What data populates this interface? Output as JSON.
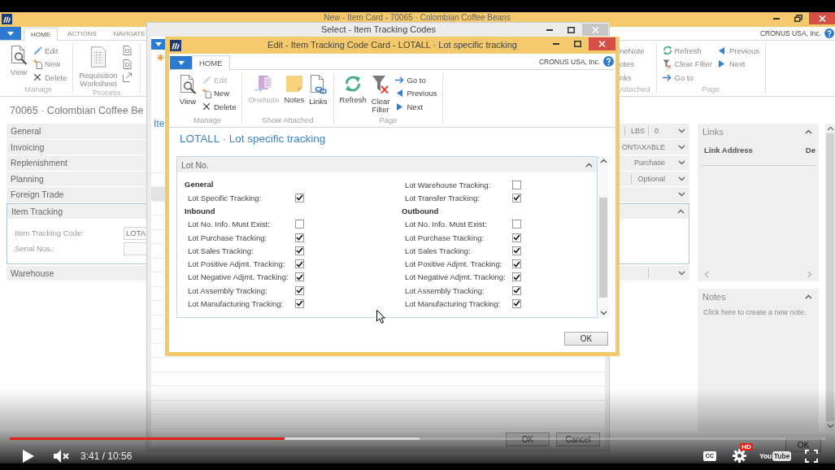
{
  "background_window": {
    "title": "New - Item Card - 70065 · Colombian Coffee Beans",
    "active": true,
    "maximized": true,
    "tabs": [
      {
        "label": "HOME",
        "selected": true
      },
      {
        "label": "ACTIONS",
        "selected": false
      },
      {
        "label": "NAVIGATE",
        "selected": false
      }
    ],
    "company": "CRONUS USA, Inc.",
    "ribbon_left": [
      {
        "label": "Manage",
        "items": [
          {
            "kind": "large",
            "label": "View"
          },
          {
            "kind": "small",
            "label": "Edit"
          },
          {
            "kind": "small",
            "label": "New"
          },
          {
            "kind": "small",
            "label": "Delete"
          }
        ]
      },
      {
        "label": "Process",
        "items": [
          {
            "kind": "large",
            "label": "Requisition Worksheet"
          },
          {
            "kind": "icon"
          },
          {
            "kind": "icon"
          },
          {
            "kind": "icon"
          }
        ]
      }
    ],
    "ribbon_right": [
      {
        "label": "Attached",
        "items": [
          {
            "kind": "small",
            "label": "neNote"
          },
          {
            "kind": "small",
            "label": "otes"
          },
          {
            "kind": "small",
            "label": "nks"
          }
        ]
      },
      {
        "label": "Page",
        "items": [
          {
            "kind": "small",
            "label": "Refresh"
          },
          {
            "kind": "small",
            "label": "Clear Filter"
          },
          {
            "kind": "small",
            "label": "Go to"
          },
          {
            "kind": "small",
            "label": "Previous"
          },
          {
            "kind": "small",
            "label": "Next"
          }
        ]
      }
    ],
    "heading": "70065 · Colombian Coffee Be",
    "fasttabs": [
      {
        "label": "General",
        "expanded": false,
        "summary": [
          {
            "text": "LBS",
            "divider": true
          },
          {
            "text": "0",
            "divider": true
          }
        ]
      },
      {
        "label": "Invoicing",
        "expanded": false,
        "summary": [
          {
            "text": "ONTAXABLE",
            "divider": false
          }
        ]
      },
      {
        "label": "Replenishment",
        "expanded": false,
        "summary": [
          {
            "text": "Purchase",
            "divider": false
          }
        ]
      },
      {
        "label": "Planning",
        "expanded": false,
        "summary": [
          {
            "text": "Optional",
            "divider": true
          }
        ]
      },
      {
        "label": "Foreign Trade",
        "expanded": false
      },
      {
        "label": "Item Tracking",
        "expanded": true,
        "fields": [
          {
            "label": "Item Tracking Code:",
            "value": "LOTA"
          },
          {
            "label": "Serial Nos.:"
          }
        ]
      },
      {
        "label": "Warehouse",
        "expanded": false,
        "summary": [
          {
            "divider": true
          }
        ]
      }
    ],
    "factboxes": [
      {
        "kind": "links",
        "title": "Links",
        "expanded": true,
        "columns": [
          "Link Address",
          "De"
        ]
      },
      {
        "kind": "notes",
        "title": "Notes",
        "expanded": true,
        "text": "Click here to create a new note."
      }
    ],
    "ok_button": "OK"
  },
  "select_window": {
    "title": "Select - Item Tracking Codes",
    "active": false,
    "maximized": false,
    "heading": "Ite",
    "rows": [
      {
        "selected": false
      },
      {
        "selected": false
      },
      {
        "selected": true
      },
      {
        "selected": false
      },
      {
        "selected": false
      },
      {
        "selected": false
      },
      {
        "selected": false
      },
      {
        "selected": false
      },
      {
        "selected": false
      },
      {
        "selected": false
      },
      {
        "selected": false
      },
      {
        "selected": false
      },
      {
        "selected": false
      },
      {
        "selected": false
      },
      {
        "selected": false
      },
      {
        "selected": false
      },
      {
        "selected": false
      },
      {
        "selected": false
      },
      {
        "selected": false
      }
    ],
    "buttons": [
      "OK",
      "Cancel"
    ]
  },
  "dialog": {
    "title": "Edit - Item Tracking Code Card - LOTALL · Lot specific tracking",
    "active": true,
    "maximized": false,
    "tabs": [
      {
        "label": "HOME",
        "selected": true
      }
    ],
    "company": "CRONUS USA, Inc.",
    "ribbon": [
      {
        "label": "Manage",
        "items": [
          {
            "kind": "large",
            "label": "View",
            "disabled": false
          },
          {
            "kind": "small",
            "label": "Edit",
            "disabled": true
          },
          {
            "kind": "small",
            "label": "New",
            "disabled": false
          },
          {
            "kind": "small",
            "label": "Delete",
            "disabled": false
          }
        ]
      },
      {
        "label": "Show Attached",
        "items": [
          {
            "kind": "large",
            "label": "OneNote",
            "disabled": true
          },
          {
            "kind": "large",
            "label": "Notes",
            "disabled": false
          },
          {
            "kind": "large",
            "label": "Links",
            "disabled": false
          }
        ]
      },
      {
        "label": "Page",
        "items": [
          {
            "kind": "large",
            "label": "Refresh",
            "disabled": false
          },
          {
            "kind": "large",
            "label": "Clear Filter",
            "disabled": false
          },
          {
            "kind": "small",
            "label": "Go to",
            "disabled": false
          },
          {
            "kind": "small",
            "label": "Previous",
            "disabled": false
          },
          {
            "kind": "small",
            "label": "Next",
            "disabled": false
          }
        ]
      }
    ],
    "heading": "LOTALL · Lot specific tracking",
    "fasttab": {
      "label": "Lot No.",
      "expanded": true,
      "columns": [
        [
          {
            "kind": "heading",
            "label": "General"
          },
          {
            "kind": "field",
            "label": "Lot Specific Tracking:",
            "checked": true
          },
          {
            "kind": "heading",
            "label": "Inbound"
          },
          {
            "kind": "field",
            "label": "Lot No. Info. Must Exist:",
            "checked": false
          },
          {
            "kind": "field",
            "label": "Lot Purchase Tracking:",
            "checked": true
          },
          {
            "kind": "field",
            "label": "Lot Sales Tracking:",
            "checked": true
          },
          {
            "kind": "field",
            "label": "Lot Positive Adjmt. Tracking:",
            "checked": true
          },
          {
            "kind": "field",
            "label": "Lot Negative Adjmt. Tracking:",
            "checked": true
          },
          {
            "kind": "field",
            "label": "Lot Assembly Tracking:",
            "checked": true
          },
          {
            "kind": "field",
            "label": "Lot Manufacturing Tracking:",
            "checked": true
          }
        ],
        [
          {
            "kind": "field",
            "label": "Lot Warehouse Tracking:",
            "checked": false
          },
          {
            "kind": "field",
            "label": "Lot Transfer Tracking:",
            "checked": true
          },
          {
            "kind": "heading",
            "label": "Outbound"
          },
          {
            "kind": "field",
            "label": "Lot No. Info. Must Exist:",
            "checked": false
          },
          {
            "kind": "field",
            "label": "Lot Purchase Tracking:",
            "checked": true
          },
          {
            "kind": "field",
            "label": "Lot Sales Tracking:",
            "checked": true
          },
          {
            "kind": "field",
            "label": "Lot Positive Adjmt. Tracking:",
            "checked": true
          },
          {
            "kind": "field",
            "label": "Lot Negative Adjmt. Tracking:",
            "checked": true
          },
          {
            "kind": "field",
            "label": "Lot Assembly Tracking:",
            "checked": true
          },
          {
            "kind": "field",
            "label": "Lot Manufacturing Tracking:",
            "checked": true
          }
        ]
      ]
    },
    "ok_button": "OK"
  },
  "video_player": {
    "playing": false,
    "muted": true,
    "progress": {
      "level": 0.337,
      "buffer": {
        "level": 0.502
      }
    },
    "time": "3:41 / 10:56",
    "captions": "CC",
    "quality_badge": "HD",
    "logo": {
      "text": "You",
      "boxed_text": "Tube"
    }
  }
}
